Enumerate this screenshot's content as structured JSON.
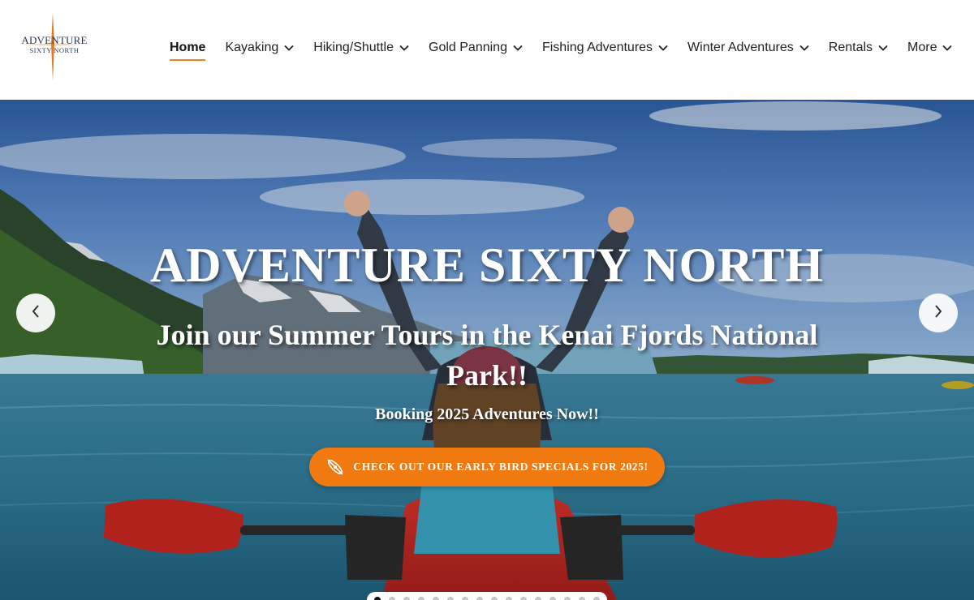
{
  "logo": {
    "line1": "ADVENTURE",
    "line2": "SIXTY NORTH",
    "accent_color": "#e07a20",
    "text_color": "#1f3558"
  },
  "nav": {
    "items": [
      {
        "label": "Home",
        "active": true,
        "dropdown": false
      },
      {
        "label": "Kayaking",
        "dropdown": true
      },
      {
        "label": "Hiking/Shuttle",
        "dropdown": true
      },
      {
        "label": "Gold Panning",
        "dropdown": true
      },
      {
        "label": "Fishing Adventures",
        "dropdown": true
      },
      {
        "label": "Winter Adventures",
        "dropdown": true
      },
      {
        "label": "Rentals",
        "dropdown": true
      },
      {
        "label": "More",
        "dropdown": true
      }
    ],
    "dropdown_icon": "chevron-down-icon",
    "active_underline_color": "#f0831f"
  },
  "hero": {
    "title": "ADVENTURE SIXTY NORTH",
    "subtitle": "Join our Summer Tours in the Kenai Fjords National Park!!",
    "booking": "Booking 2025 Adventures Now!!",
    "cta_label": "CHECK OUT OUR EARLY BIRD SPECIALS FOR 2025!",
    "cta_icon": "kayak-paddle-icon",
    "cta_color": "#f07a10",
    "prev_icon": "chevron-left-icon",
    "next_icon": "chevron-right-icon",
    "slide_count": 16,
    "active_slide": 1
  }
}
